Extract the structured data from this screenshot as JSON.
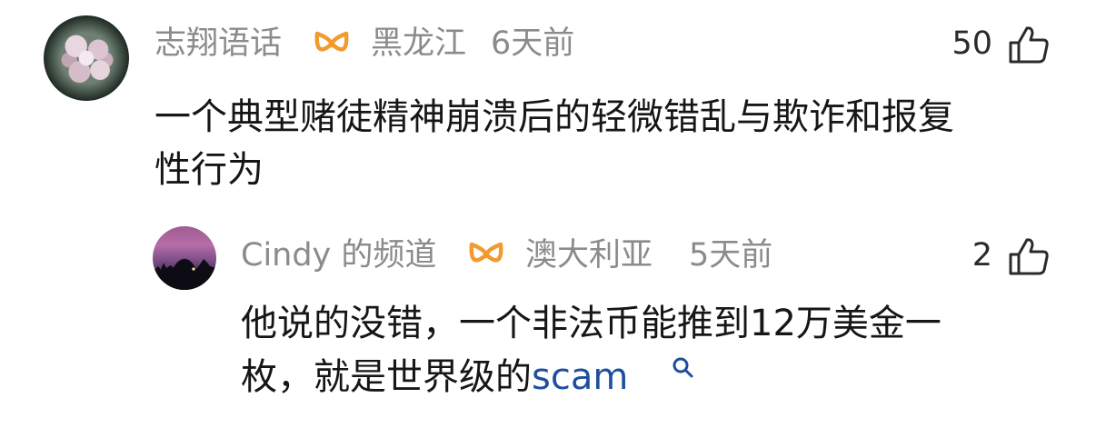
{
  "comments": [
    {
      "username": "志翔语话",
      "location": "黑龙江",
      "time": "6天前",
      "likes": "50",
      "badge_icon": "vip-badge-icon",
      "text_lines": [
        "一个典型赌徒精神崩溃后的轻微错乱与欺诈和报复",
        "性行为"
      ]
    },
    {
      "username": "Cindy 的频道",
      "location": "澳大利亚",
      "time": "5天前",
      "likes": "2",
      "badge_icon": "vip-badge-icon",
      "text_line1": "他说的没错，一个非法币能推到12万美金一",
      "text_line2_prefix": "枚，就是世界级的",
      "text_link": "scam"
    }
  ],
  "colors": {
    "meta_gray": "#8b8b8b",
    "badge_orange": "#f29a2e",
    "link_blue": "#1f4f9c",
    "text": "#161616"
  }
}
